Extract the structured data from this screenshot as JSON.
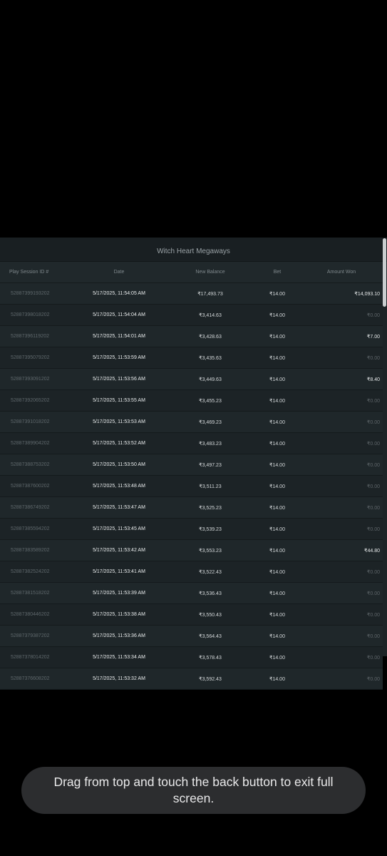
{
  "game_title": "Witch Heart Megaways",
  "columns": {
    "session_id": "Play Session ID #",
    "date": "Date",
    "new_balance": "New Balance",
    "bet": "Bet",
    "amount_won": "Amount Won"
  },
  "rows": [
    {
      "id": "52887399193202",
      "date": "5/17/2025, 11:54:05 AM",
      "balance": "₹17,493.73",
      "bet": "₹14.00",
      "won": "₹14,093.10",
      "hit": true
    },
    {
      "id": "52887398018202",
      "date": "5/17/2025, 11:54:04 AM",
      "balance": "₹3,414.63",
      "bet": "₹14.00",
      "won": "₹0.00",
      "hit": false
    },
    {
      "id": "52887396119202",
      "date": "5/17/2025, 11:54:01 AM",
      "balance": "₹3,428.63",
      "bet": "₹14.00",
      "won": "₹7.00",
      "hit": true
    },
    {
      "id": "52887395079202",
      "date": "5/17/2025, 11:53:59 AM",
      "balance": "₹3,435.63",
      "bet": "₹14.00",
      "won": "₹0.00",
      "hit": false
    },
    {
      "id": "52887393091202",
      "date": "5/17/2025, 11:53:56 AM",
      "balance": "₹3,449.63",
      "bet": "₹14.00",
      "won": "₹8.40",
      "hit": true
    },
    {
      "id": "52887392065202",
      "date": "5/17/2025, 11:53:55 AM",
      "balance": "₹3,455.23",
      "bet": "₹14.00",
      "won": "₹0.00",
      "hit": false
    },
    {
      "id": "52887391018202",
      "date": "5/17/2025, 11:53:53 AM",
      "balance": "₹3,469.23",
      "bet": "₹14.00",
      "won": "₹0.00",
      "hit": false
    },
    {
      "id": "52887389904202",
      "date": "5/17/2025, 11:53:52 AM",
      "balance": "₹3,483.23",
      "bet": "₹14.00",
      "won": "₹0.00",
      "hit": false
    },
    {
      "id": "52887388753202",
      "date": "5/17/2025, 11:53:50 AM",
      "balance": "₹3,497.23",
      "bet": "₹14.00",
      "won": "₹0.00",
      "hit": false
    },
    {
      "id": "52887387600202",
      "date": "5/17/2025, 11:53:48 AM",
      "balance": "₹3,511.23",
      "bet": "₹14.00",
      "won": "₹0.00",
      "hit": false
    },
    {
      "id": "52887386749202",
      "date": "5/17/2025, 11:53:47 AM",
      "balance": "₹3,525.23",
      "bet": "₹14.00",
      "won": "₹0.00",
      "hit": false
    },
    {
      "id": "52887385594202",
      "date": "5/17/2025, 11:53:45 AM",
      "balance": "₹3,539.23",
      "bet": "₹14.00",
      "won": "₹0.00",
      "hit": false
    },
    {
      "id": "52887383589202",
      "date": "5/17/2025, 11:53:42 AM",
      "balance": "₹3,553.23",
      "bet": "₹14.00",
      "won": "₹44.80",
      "hit": true
    },
    {
      "id": "52887382524202",
      "date": "5/17/2025, 11:53:41 AM",
      "balance": "₹3,522.43",
      "bet": "₹14.00",
      "won": "₹0.00",
      "hit": false
    },
    {
      "id": "52887381518202",
      "date": "5/17/2025, 11:53:39 AM",
      "balance": "₹3,536.43",
      "bet": "₹14.00",
      "won": "₹0.00",
      "hit": false
    },
    {
      "id": "52887380446202",
      "date": "5/17/2025, 11:53:38 AM",
      "balance": "₹3,550.43",
      "bet": "₹14.00",
      "won": "₹0.00",
      "hit": false
    },
    {
      "id": "52887379387202",
      "date": "5/17/2025, 11:53:36 AM",
      "balance": "₹3,564.43",
      "bet": "₹14.00",
      "won": "₹0.00",
      "hit": false
    },
    {
      "id": "52887378014202",
      "date": "5/17/2025, 11:53:34 AM",
      "balance": "₹3,578.43",
      "bet": "₹14.00",
      "won": "₹0.00",
      "hit": false
    },
    {
      "id": "52887376608202",
      "date": "5/17/2025, 11:53:32 AM",
      "balance": "₹3,592.43",
      "bet": "₹14.00",
      "won": "₹0.00",
      "hit": false
    }
  ],
  "toast": "Drag from top and touch the back button to exit full screen.",
  "colors": {
    "background": "#000000",
    "panel": "#1d2427",
    "header_bar": "#191f22",
    "win_text": "#e6e9ea",
    "zero_text": "#5d6468",
    "toast_bg": "#2c2d2f"
  }
}
